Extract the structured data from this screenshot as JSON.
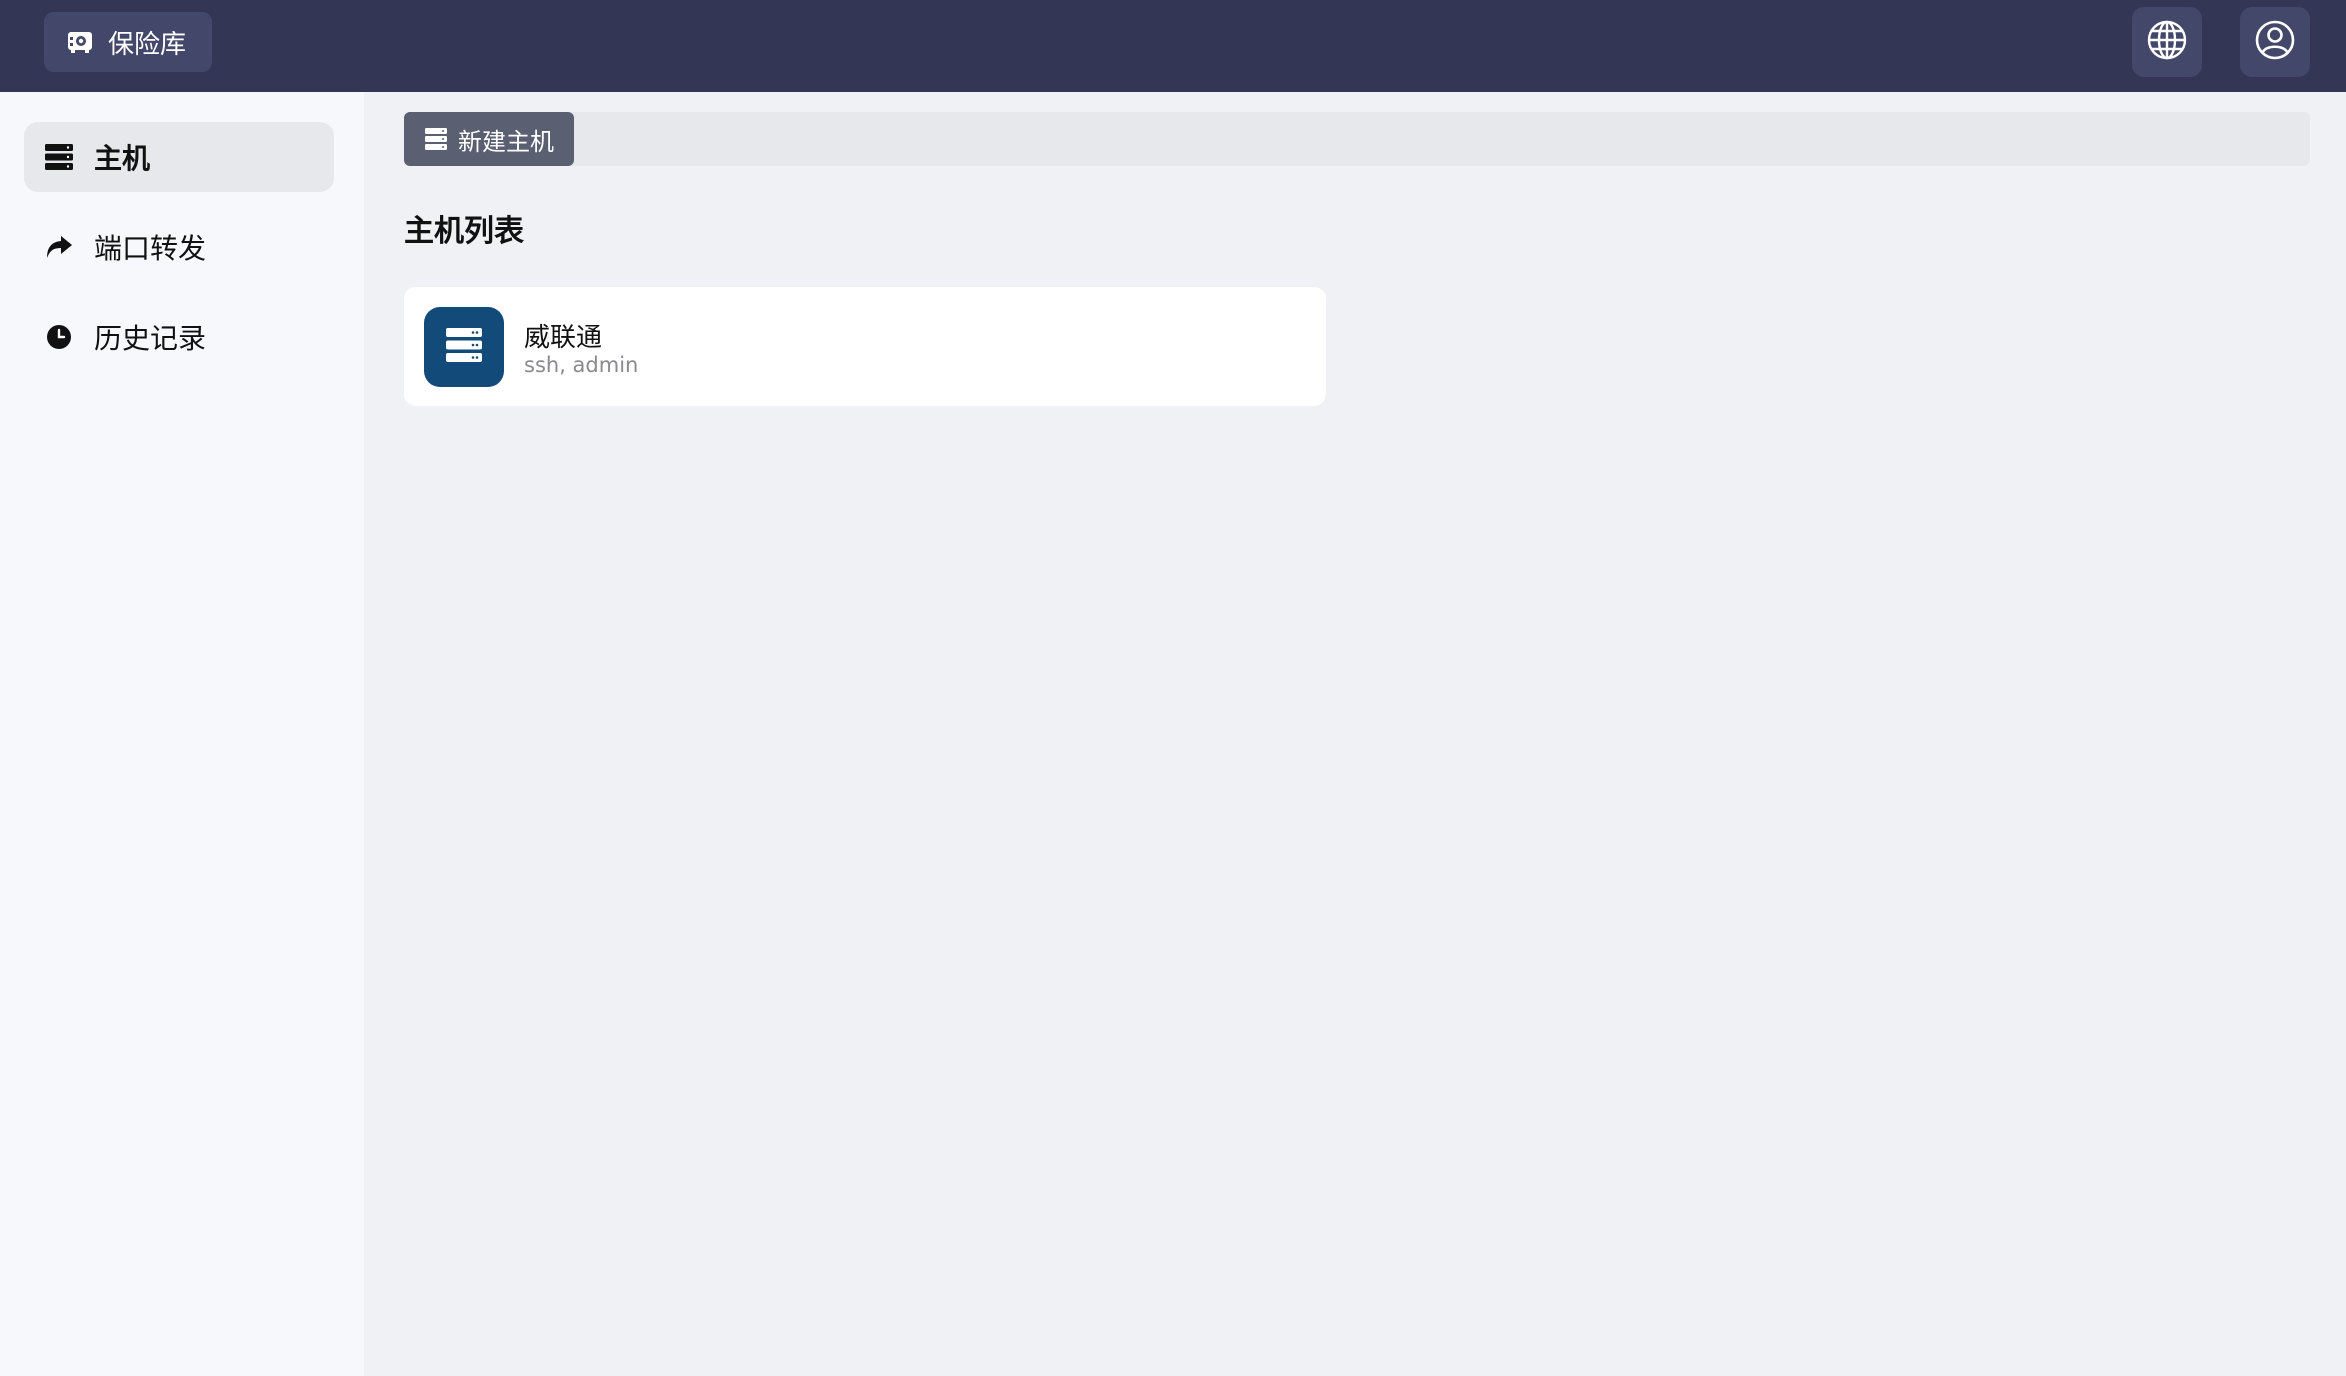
{
  "topbar": {
    "brand_label": "保险库",
    "brand_icon": "vault-icon",
    "globe_icon": "globe-icon",
    "user_icon": "user-circle-icon"
  },
  "sidebar": {
    "items": [
      {
        "label": "主机",
        "icon": "server-icon",
        "active": true
      },
      {
        "label": "端口转发",
        "icon": "share-forward-icon",
        "active": false
      },
      {
        "label": "历史记录",
        "icon": "clock-icon",
        "active": false
      }
    ]
  },
  "main": {
    "new_host_label": "新建主机",
    "section_title": "主机列表",
    "hosts": [
      {
        "name": "威联通",
        "meta": "ssh, admin"
      }
    ]
  },
  "colors": {
    "topbar_bg": "#333755",
    "host_avatar_bg": "#124a7a",
    "new_button_bg": "#5b5f72"
  }
}
